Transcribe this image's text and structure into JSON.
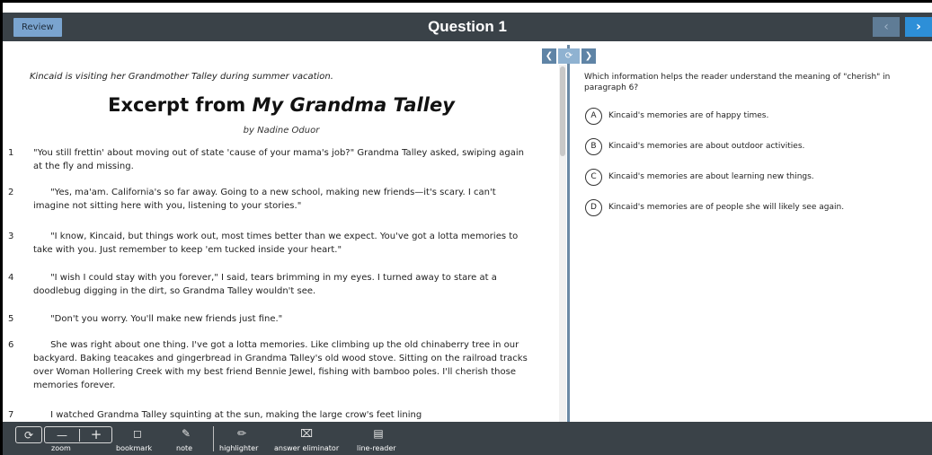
{
  "header": {
    "review_label": "Review",
    "title": "Question 1",
    "prev_icon": "chevron-left-icon",
    "next_icon": "chevron-right-icon"
  },
  "passage": {
    "intro": "Kincaid is visiting her Grandmother Talley during summer vacation.",
    "title_prefix": "Excerpt from ",
    "title_italic": "My Grandma Talley",
    "byline": "by Nadine Oduor",
    "paragraphs": [
      {
        "num": "1",
        "text": "\"You still frettin' about moving out of state 'cause of your mama's job?\" Grandma Talley asked, swiping again at the fly and missing."
      },
      {
        "num": "2",
        "text": "      \"Yes, ma'am. California's so far away. Going to a new school, making new friends—it's scary. I can't imagine not sitting here with you, listening to your stories.\""
      },
      {
        "num": "3",
        "text": "      \"I know, Kincaid, but things work out, most times better than we expect. You've got a lotta memories to take with you. Just remember to keep 'em tucked inside your heart.\""
      },
      {
        "num": "4",
        "text": "      \"I wish I could stay with you forever,\" I said, tears brimming in my eyes. I turned away to stare at a doodlebug digging in the dirt, so Grandma Talley wouldn't see."
      },
      {
        "num": "5",
        "text": "      \"Don't you worry. You'll make new friends just fine.\""
      },
      {
        "num": "6",
        "text": "      She was right about one thing. I've got a lotta memories. Like climbing up the old chinaberry tree in our backyard. Baking teacakes and gingerbread in Grandma Talley's old wood stove. Sitting on the railroad tracks over Woman Hollering Creek with my best friend Bennie Jewel, fishing with bamboo poles. I'll cherish those memories forever."
      },
      {
        "num": "7",
        "text": "      I watched Grandma Talley squinting at the sun, making the large crow's feet lining"
      }
    ]
  },
  "question": {
    "prompt": "Which information helps the reader understand the meaning of \"cherish\" in paragraph 6?",
    "choices": [
      {
        "letter": "A",
        "text": "Kincaid's memories are of happy times."
      },
      {
        "letter": "B",
        "text": "Kincaid's memories are about outdoor activities."
      },
      {
        "letter": "C",
        "text": "Kincaid's memories are about learning new things."
      },
      {
        "letter": "D",
        "text": "Kincaid's memories are of people she will likely see again."
      }
    ]
  },
  "toolbar": {
    "zoom_label": "zoom",
    "bookmark_label": "bookmark",
    "note_label": "note",
    "highlighter_label": "highlighter",
    "answer_eliminator_label": "answer eliminator",
    "line_reader_label": "line-reader"
  },
  "colors": {
    "header_bg": "#3a4248",
    "review_bg": "#7aa4cf",
    "next_bg": "#2d8fd8",
    "divider": "#6b8aa6"
  }
}
